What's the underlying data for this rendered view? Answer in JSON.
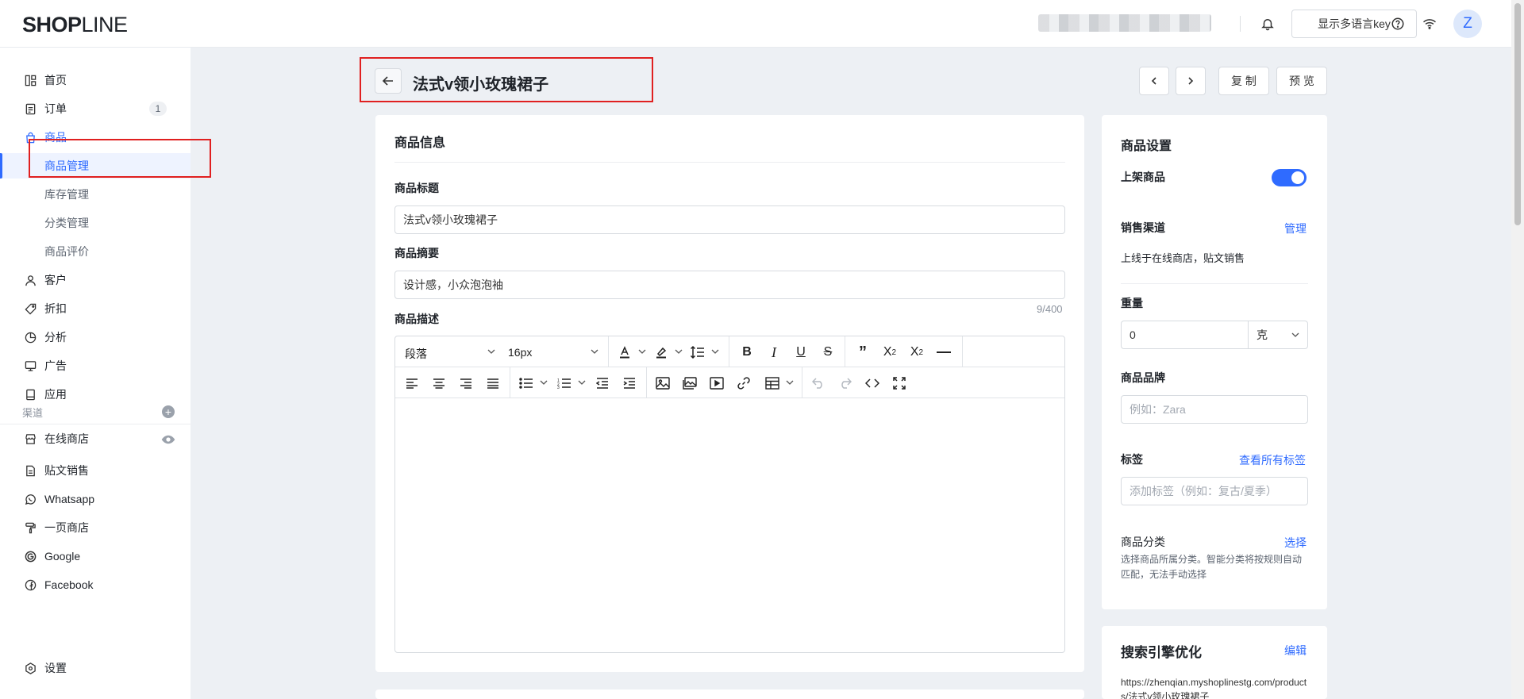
{
  "topbar": {
    "logo_bold": "SHOP",
    "logo_light": "LINE",
    "lang_button": "显示多语言key",
    "avatar_initial": "Z"
  },
  "sidebar": {
    "items": [
      {
        "label": "首页"
      },
      {
        "label": "订单",
        "badge": "1"
      },
      {
        "label": "商品"
      },
      {
        "label": "商品管理"
      },
      {
        "label": "库存管理"
      },
      {
        "label": "分类管理"
      },
      {
        "label": "商品评价"
      },
      {
        "label": "客户"
      },
      {
        "label": "折扣"
      },
      {
        "label": "分析"
      },
      {
        "label": "广告"
      },
      {
        "label": "应用"
      }
    ],
    "channels_label": "渠道",
    "channels": [
      {
        "label": "在线商店"
      },
      {
        "label": "贴文销售"
      },
      {
        "label": "Whatsapp"
      },
      {
        "label": "一页商店"
      },
      {
        "label": "Google"
      },
      {
        "label": "Facebook"
      }
    ],
    "settings": "设置"
  },
  "header": {
    "title": "法式v领小玫瑰裙子",
    "copy_button": "复 制",
    "preview_button": "预 览"
  },
  "product_info": {
    "card_title": "商品信息",
    "title_label": "商品标题",
    "title_value": "法式v领小玫瑰裙子",
    "summary_label": "商品摘要",
    "summary_value": "设计感，小众泡泡袖",
    "summary_counter": "9/400",
    "description_label": "商品描述",
    "editor": {
      "block_format": "段落",
      "font_size": "16px"
    }
  },
  "settings_card": {
    "title": "商品设置",
    "publish_label": "上架商品",
    "publish_on": true,
    "channels_label": "销售渠道",
    "channels_manage": "管理",
    "channels_text": "上线于在线商店，贴文销售",
    "weight_label": "重量",
    "weight_value": "0",
    "weight_unit": "克",
    "brand_label": "商品品牌",
    "brand_placeholder": "例如：Zara",
    "tags_label": "标签",
    "tags_link": "查看所有标签",
    "tags_placeholder": "添加标签（例如：复古/夏季）",
    "category_label": "商品分类",
    "category_link": "选择",
    "category_help": "选择商品所属分类。智能分类将按规则自动匹配，无法手动选择"
  },
  "seo_card": {
    "title": "搜索引擎优化",
    "edit_link": "编辑",
    "url": "https://zhenqian.myshoplinestg.com/products/法式v领小玫瑰裙子"
  },
  "colors": {
    "accent": "#2f6bff",
    "annotation": "#e02020"
  }
}
